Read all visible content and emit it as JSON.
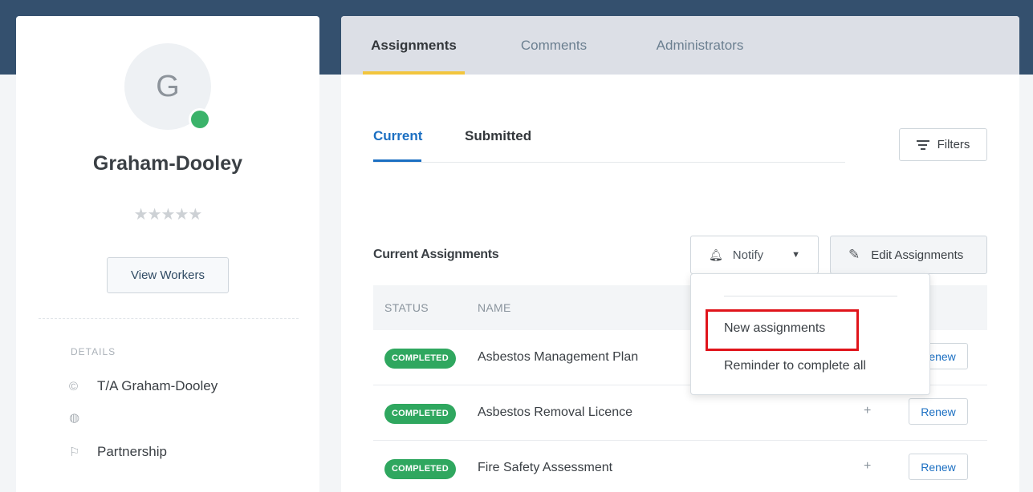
{
  "profile": {
    "avatar_initial": "G",
    "status_color": "#3bb36a",
    "company_name": "Graham-Dooley",
    "rating_stars": "★★★★★",
    "rating_value": 0,
    "view_workers_label": "View Workers",
    "details_label": "DETAILS",
    "details": [
      {
        "icon": "copyright-icon",
        "glyph": "©",
        "text": "T/A Graham-Dooley"
      },
      {
        "icon": "globe-icon",
        "glyph": "◍",
        "text": ""
      },
      {
        "icon": "flag-icon",
        "glyph": "⚐",
        "text": "Partnership"
      }
    ]
  },
  "tabs": [
    {
      "label": "Assignments",
      "active": true
    },
    {
      "label": "Comments",
      "active": false
    },
    {
      "label": "Administrators",
      "active": false
    }
  ],
  "subtabs": [
    {
      "label": "Current",
      "active": true
    },
    {
      "label": "Submitted",
      "active": false
    }
  ],
  "filters_label": "Filters",
  "section_title": "Current Assignments",
  "notify": {
    "label": "Notify",
    "caret": "▼"
  },
  "edit_assignments_label": "Edit Assignments",
  "table": {
    "headers": [
      "STATUS",
      "NAME"
    ],
    "rows": [
      {
        "status": "COMPLETED",
        "name": "Asbestos Management Plan",
        "plus": "",
        "action": "Renew"
      },
      {
        "status": "COMPLETED",
        "name": "Asbestos Removal Licence",
        "plus": "+",
        "action": "Renew"
      },
      {
        "status": "COMPLETED",
        "name": "Fire Safety Assessment",
        "plus": "+",
        "action": "Renew"
      }
    ]
  },
  "notify_menu": {
    "items": [
      "New assignments",
      "Reminder to complete all"
    ],
    "highlighted_item": "New assignments",
    "highlight_color": "#e0141b"
  },
  "colors": {
    "header_band": "#34506e",
    "active_tab_underline": "#f2c53d",
    "link_blue": "#1b6fc2",
    "badge_green": "#2fa75f"
  }
}
